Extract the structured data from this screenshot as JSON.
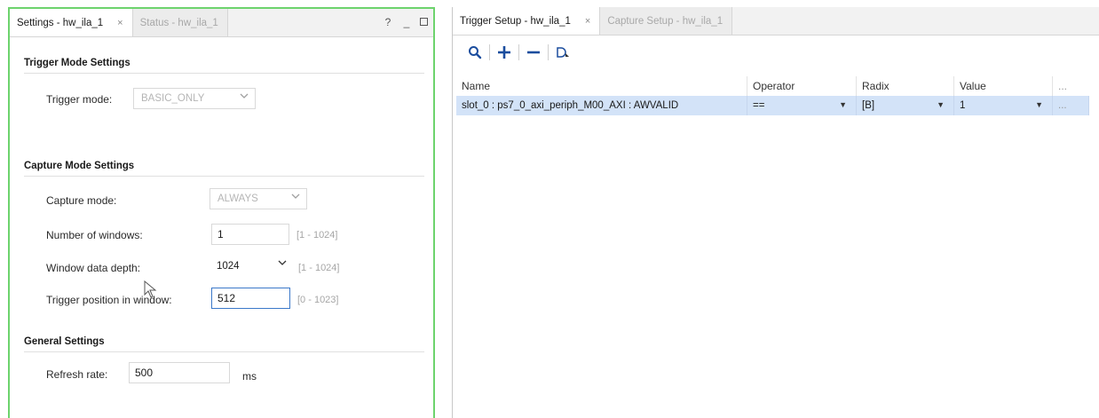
{
  "left_tabs": [
    {
      "label": "Settings - hw_ila_1",
      "close": "×"
    },
    {
      "label": "Status - hw_ila_1"
    }
  ],
  "window_controls": {
    "help": "?",
    "minimize": "_"
  },
  "trigger_mode": {
    "title": "Trigger Mode Settings",
    "label": "Trigger mode:",
    "value": "BASIC_ONLY"
  },
  "capture_mode": {
    "title": "Capture Mode Settings",
    "mode_label": "Capture mode:",
    "mode_value": "ALWAYS",
    "windows_label": "Number of windows:",
    "windows_value": "1",
    "windows_range": "[1 - 1024]",
    "depth_label": "Window data depth:",
    "depth_value": "1024",
    "depth_range": "[1 - 1024]",
    "position_label": "Trigger position in window:",
    "position_value": "512",
    "position_range": "[0 - 1023]"
  },
  "general": {
    "title": "General Settings",
    "refresh_label": "Refresh rate:",
    "refresh_value": "500",
    "refresh_unit": "ms"
  },
  "right_tabs": [
    {
      "label": "Trigger Setup - hw_ila_1",
      "close": "×"
    },
    {
      "label": "Capture Setup - hw_ila_1"
    }
  ],
  "toolbar_icons": [
    "search-icon",
    "add-icon",
    "remove-icon",
    "trigger-condition-icon"
  ],
  "grid": {
    "headers": [
      "Name",
      "Operator",
      "Radix",
      "Value",
      "..."
    ],
    "rows": [
      {
        "name": "slot_0 : ps7_0_axi_periph_M00_AXI : AWVALID",
        "operator": "==",
        "radix": "[B]",
        "value": "1",
        "more": "..."
      }
    ]
  },
  "colors": {
    "focus_border": "#6dd36d",
    "selection": "#d3e3f8",
    "icon_blue": "#1b4d9e"
  }
}
